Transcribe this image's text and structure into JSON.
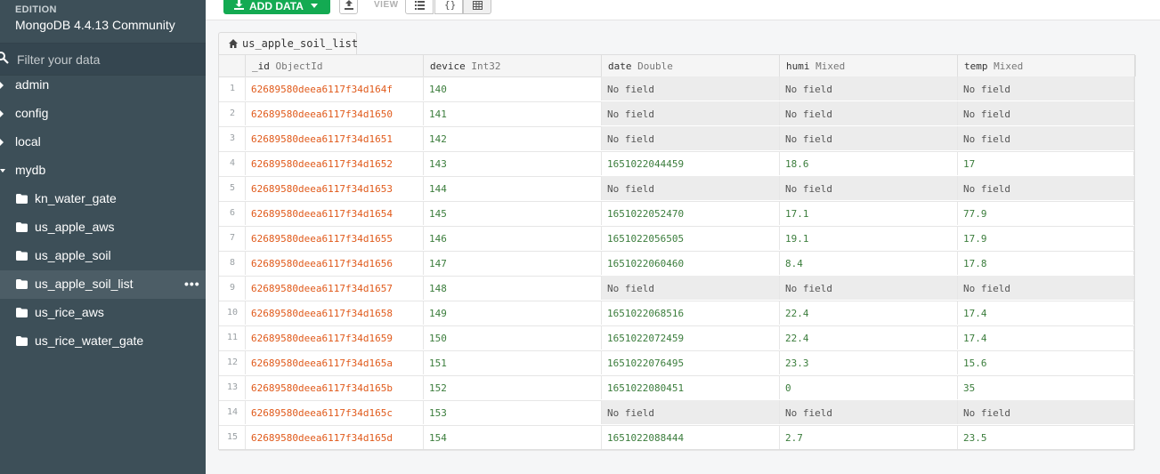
{
  "sidebar": {
    "edition_heading": "EDITION",
    "edition_value": "MongoDB 4.4.13 Community",
    "filter_placeholder": "Filter your data",
    "databases": [
      {
        "label": "admin"
      },
      {
        "label": "config"
      },
      {
        "label": "local"
      },
      {
        "label": "mydb"
      }
    ],
    "collections": [
      {
        "label": "kn_water_gate"
      },
      {
        "label": "us_apple_aws"
      },
      {
        "label": "us_apple_soil"
      },
      {
        "label": "us_apple_soil_list",
        "active": true,
        "more": "•••"
      },
      {
        "label": "us_rice_aws"
      },
      {
        "label": "us_rice_water_gate"
      }
    ]
  },
  "toolbar": {
    "add_data_label": "ADD DATA",
    "view_label": "VIEW",
    "view_json_glyph": "{}"
  },
  "tab": {
    "label": "us_apple_soil_list"
  },
  "table": {
    "columns": [
      {
        "name": "_id",
        "type": "ObjectId"
      },
      {
        "name": "device",
        "type": "Int32"
      },
      {
        "name": "date",
        "type": "Double"
      },
      {
        "name": "humi",
        "type": "Mixed"
      },
      {
        "name": "temp",
        "type": "Mixed"
      }
    ],
    "no_field_text": "No field",
    "rows": [
      {
        "n": "1",
        "id": "62689580deea6117f34d164f",
        "device": "140",
        "date": "No field",
        "humi": "No field",
        "temp": "No field"
      },
      {
        "n": "2",
        "id": "62689580deea6117f34d1650",
        "device": "141",
        "date": "No field",
        "humi": "No field",
        "temp": "No field"
      },
      {
        "n": "3",
        "id": "62689580deea6117f34d1651",
        "device": "142",
        "date": "No field",
        "humi": "No field",
        "temp": "No field"
      },
      {
        "n": "4",
        "id": "62689580deea6117f34d1652",
        "device": "143",
        "date": "1651022044459",
        "humi": "18.6",
        "temp": "17"
      },
      {
        "n": "5",
        "id": "62689580deea6117f34d1653",
        "device": "144",
        "date": "No field",
        "humi": "No field",
        "temp": "No field"
      },
      {
        "n": "6",
        "id": "62689580deea6117f34d1654",
        "device": "145",
        "date": "1651022052470",
        "humi": "17.1",
        "temp": "77.9"
      },
      {
        "n": "7",
        "id": "62689580deea6117f34d1655",
        "device": "146",
        "date": "1651022056505",
        "humi": "19.1",
        "temp": "17.9"
      },
      {
        "n": "8",
        "id": "62689580deea6117f34d1656",
        "device": "147",
        "date": "1651022060460",
        "humi": "8.4",
        "temp": "17.8"
      },
      {
        "n": "9",
        "id": "62689580deea6117f34d1657",
        "device": "148",
        "date": "No field",
        "humi": "No field",
        "temp": "No field"
      },
      {
        "n": "10",
        "id": "62689580deea6117f34d1658",
        "device": "149",
        "date": "1651022068516",
        "humi": "22.4",
        "temp": "17.4"
      },
      {
        "n": "11",
        "id": "62689580deea6117f34d1659",
        "device": "150",
        "date": "1651022072459",
        "humi": "22.4",
        "temp": "17.4"
      },
      {
        "n": "12",
        "id": "62689580deea6117f34d165a",
        "device": "151",
        "date": "1651022076495",
        "humi": "23.3",
        "temp": "15.6"
      },
      {
        "n": "13",
        "id": "62689580deea6117f34d165b",
        "device": "152",
        "date": "1651022080451",
        "humi": "0",
        "temp": "35"
      },
      {
        "n": "14",
        "id": "62689580deea6117f34d165c",
        "device": "153",
        "date": "No field",
        "humi": "No field",
        "temp": "No field"
      },
      {
        "n": "15",
        "id": "62689580deea6117f34d165d",
        "device": "154",
        "date": "1651022088444",
        "humi": "2.7",
        "temp": "23.5"
      }
    ]
  },
  "colors": {
    "sidebar_bg": "#3d4f58",
    "add_button": "#13aa52",
    "objectid_text": "#e05a1b",
    "value_text": "#3b7d3c",
    "no_field_bg": "#ececec"
  }
}
